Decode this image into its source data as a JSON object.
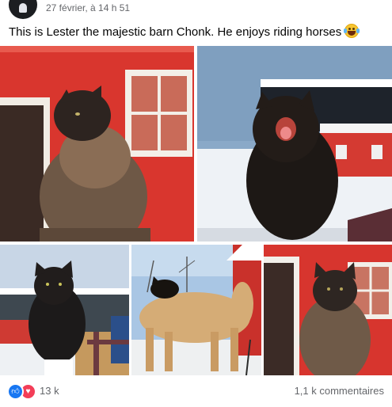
{
  "post": {
    "timestamp": "27 février, à 14 h 51",
    "caption": "This is Lester the majestic barn Chonk. He enjoys riding horses",
    "caption_emoji": "laughing-with-tears-emoji",
    "photos": [
      {
        "name": "cat-by-red-barn"
      },
      {
        "name": "cat-yawning-snow"
      },
      {
        "name": "cat-on-fence"
      },
      {
        "name": "cat-riding-horse"
      },
      {
        "name": "cat-sitting-barn-window"
      }
    ]
  },
  "footer": {
    "reaction_count": "13 k",
    "comments_label": "1,1 k commentaires",
    "reaction_icons": [
      "like-icon",
      "love-icon"
    ]
  },
  "colors": {
    "barn_red": "#d8322b",
    "facebook_blue": "#1877f2",
    "love_red": "#f33e58",
    "secondary_text": "#65676b"
  }
}
